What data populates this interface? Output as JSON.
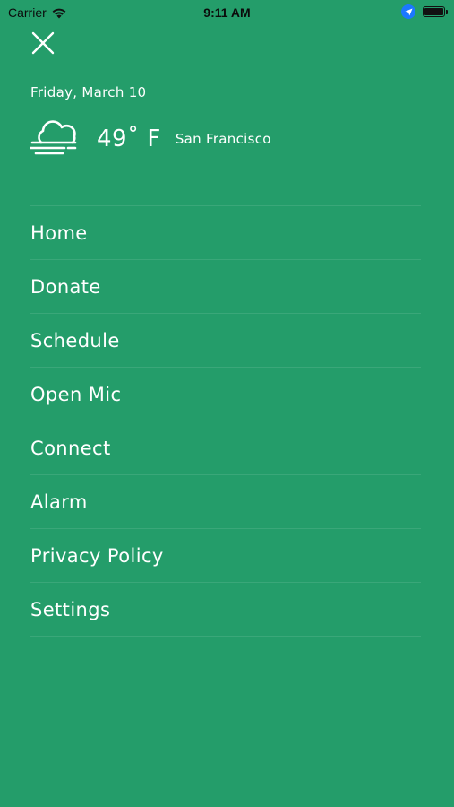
{
  "status_bar": {
    "carrier": "Carrier",
    "time": "9:11 AM",
    "icons": [
      "wifi-icon",
      "location-icon",
      "battery-icon"
    ],
    "battery_level": 1.0
  },
  "drawer": {
    "close_icon": "close-icon",
    "date": "Friday, March 10",
    "weather": {
      "icon": "fog-cloud-icon",
      "temperature": "49˚ F",
      "city": "San Francisco"
    },
    "menu": [
      {
        "label": "Home"
      },
      {
        "label": "Donate"
      },
      {
        "label": "Schedule"
      },
      {
        "label": "Open Mic"
      },
      {
        "label": "Connect"
      },
      {
        "label": "Alarm"
      },
      {
        "label": "Privacy Policy"
      },
      {
        "label": "Settings"
      }
    ]
  },
  "colors": {
    "background": "#249D6A",
    "text": "#FFFFFF",
    "divider": "rgba(255,255,255,0.10)",
    "location_badge": "#1B78FF"
  }
}
